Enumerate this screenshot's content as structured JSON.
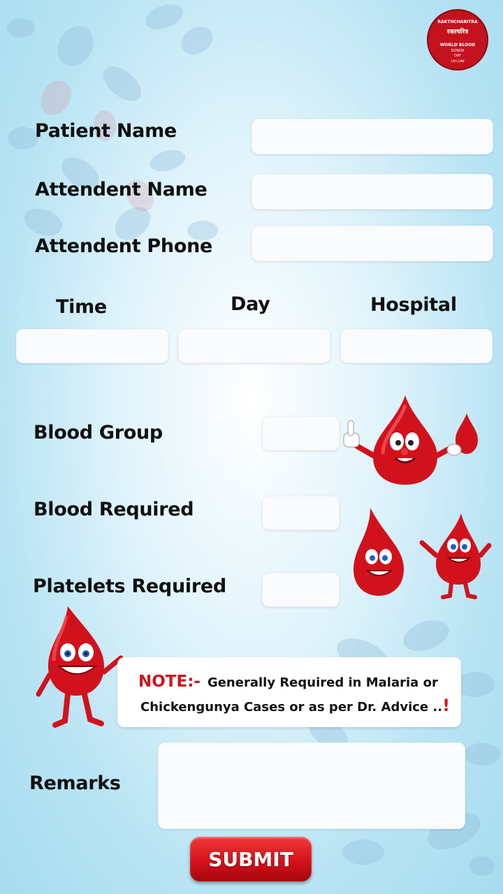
{
  "logo": {
    "top_text": "RAKTHCHARITRA",
    "hindi_text": "रक्तचरित्र",
    "event_line1": "WORLD BLOOD",
    "event_line2": "DONOR",
    "event_line3": "DAY",
    "date": "14th JUNE"
  },
  "form": {
    "patient_name_label": "Patient Name",
    "attendent_name_label": "Attendent Name",
    "attendent_phone_label": "Attendent Phone",
    "time_label": "Time",
    "day_label": "Day",
    "hospital_label": "Hospital",
    "blood_group_label": "Blood Group",
    "blood_required_label": "Blood Required",
    "platelets_required_label": "Platelets Required",
    "remarks_label": "Remarks"
  },
  "note": {
    "title": "NOTE:-",
    "line1": "Generally Required in Malaria or",
    "line2": "Chickengunya Cases or as per Dr. Advice ..",
    "exclamation": "!"
  },
  "submit_label": "SUBMIT",
  "colors": {
    "accent": "#d0131e",
    "background": "#b9e4f4"
  }
}
